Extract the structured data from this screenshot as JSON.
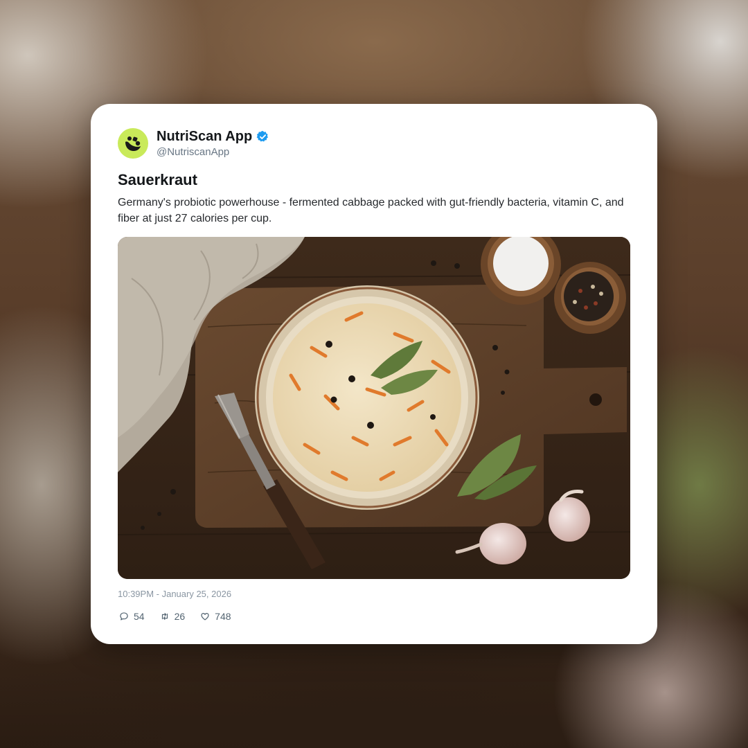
{
  "post": {
    "author_name": "NutriScan App",
    "author_handle": "@NutriscanApp",
    "verified": true,
    "title": "Sauerkraut",
    "description": "Germany's probiotic powerhouse - fermented cabbage packed with gut-friendly bacteria, vitamin C, and fiber at just 27 calories per cup.",
    "timestamp": "10:39PM - January 25, 2026",
    "stats": {
      "comments": "54",
      "retweets": "26",
      "likes": "748"
    }
  },
  "colors": {
    "avatar_bg": "#c9ea5a",
    "verified_blue": "#1d9bf0",
    "text_primary": "#14171a",
    "text_secondary": "#687684"
  },
  "icons": {
    "avatar": "nutriscan-logo-icon",
    "verified": "verified-badge-icon",
    "comment": "comment-icon",
    "retweet": "retweet-icon",
    "like": "heart-icon"
  }
}
